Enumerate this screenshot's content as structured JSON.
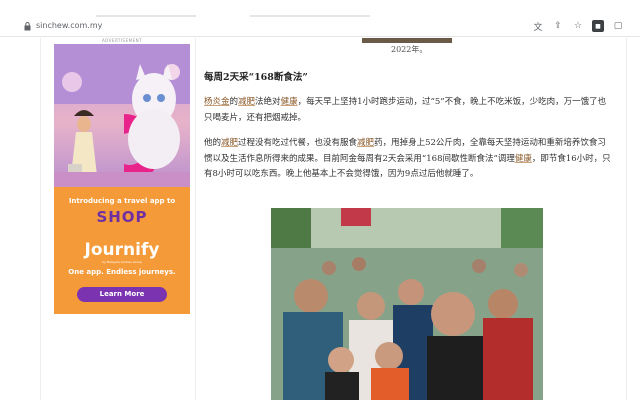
{
  "browser": {
    "url": "sinchew.com.my",
    "icons": [
      "translate-icon",
      "share-icon",
      "bookmark-star-icon",
      "extension-icon",
      "sidebar-icon"
    ]
  },
  "ad": {
    "label": "ADVERTISEMENT",
    "intro": "Introducing a travel app to",
    "shop": "SHOP",
    "brand": "Journify",
    "brand_sub": "by Malaysia Airlines Group",
    "tagline": "One app. Endless journeys.",
    "button": "Learn More",
    "colors": {
      "orange": "#f59a39",
      "purple": "#7b33b0"
    }
  },
  "article": {
    "caption": "2022年。",
    "heading": "每周2天采“168断食法”",
    "para1": {
      "link1": "杨炎金",
      "t1": "的",
      "link2": "减肥",
      "t2": "法绝对",
      "link3": "健康",
      "t3": "，每天早上坚持1小时跑步运动，过“5”不食，晚上不吃米饭，少吃肉，万一饿了也只喝麦片，还有把烟戒掉。"
    },
    "para2": {
      "t1": "他的",
      "link1": "减肥",
      "t2": "过程没有吃过代餐，也没有服食",
      "link2": "减肥",
      "t3": "药，甩掉身上52公斤肉，全靠每天坚持运动和重新培养饮食习惯以及生活作息所得来的成果。目前阿金每周有2天会采用“168间歇性断食法”调理",
      "link3": "健康",
      "t4": "，即节食16小时，只有8小时可以吃东西。晚上他基本上不会觉得饿，因为9点过后他就睡了。"
    }
  }
}
